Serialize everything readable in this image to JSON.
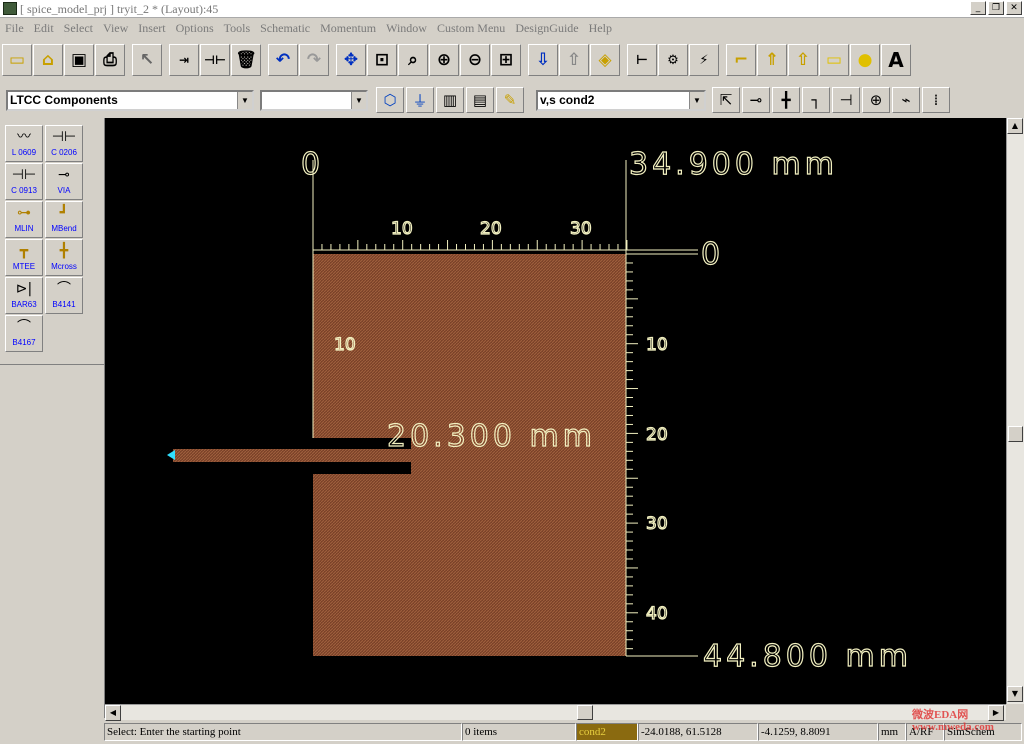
{
  "window": {
    "title": "[ spice_model_prj ] tryit_2 * (Layout):45"
  },
  "menu": [
    "File",
    "Edit",
    "Select",
    "View",
    "Insert",
    "Options",
    "Tools",
    "Schematic",
    "Momentum",
    "Window",
    "Custom Menu",
    "DesignGuide",
    "Help"
  ],
  "toolbar2": {
    "palette_combo": "LTCC Components",
    "layer_combo": "",
    "component_combo": "v,s cond2"
  },
  "palette_items": [
    {
      "label": "L 0609",
      "icon": "inductor-icon"
    },
    {
      "label": "C 0206",
      "icon": "capacitor-icon"
    },
    {
      "label": "C 0913",
      "icon": "capacitor-icon"
    },
    {
      "label": "VIA",
      "icon": "via-icon"
    },
    {
      "label": "MLIN",
      "icon": "microstrip-line-icon"
    },
    {
      "label": "MBend",
      "icon": "microstrip-bend-icon"
    },
    {
      "label": "MTEE",
      "icon": "microstrip-tee-icon"
    },
    {
      "label": "Mcross",
      "icon": "microstrip-cross-icon"
    },
    {
      "label": "BAR63",
      "icon": "diode-icon"
    },
    {
      "label": "B4141",
      "icon": "filter-icon"
    },
    {
      "label": "B4167",
      "icon": "filter-icon"
    }
  ],
  "layout": {
    "width_readout": "34.900  mm",
    "height_readout": "44.800  mm",
    "feed_readout": "20.300  mm",
    "origin_x": "0",
    "origin_y": "0",
    "x_ticks": [
      "10",
      "20",
      "30"
    ],
    "y_ticks": [
      "10",
      "20",
      "30",
      "40"
    ],
    "left_tick": "10",
    "colors": {
      "substrate": "#8a4d2e",
      "ruler": "#f2f0c0",
      "background": "#000000"
    }
  },
  "status": {
    "prompt": "Select: Enter the starting point",
    "items": "0 items",
    "layer": "cond2",
    "coord1": "-24.0188, 61.5128",
    "coord2": "-4.1259, 8.8091",
    "units": "mm",
    "mode": "A/RF",
    "view": "SimSchem",
    "watermark": "微波EDA网 www.mweda.com"
  }
}
